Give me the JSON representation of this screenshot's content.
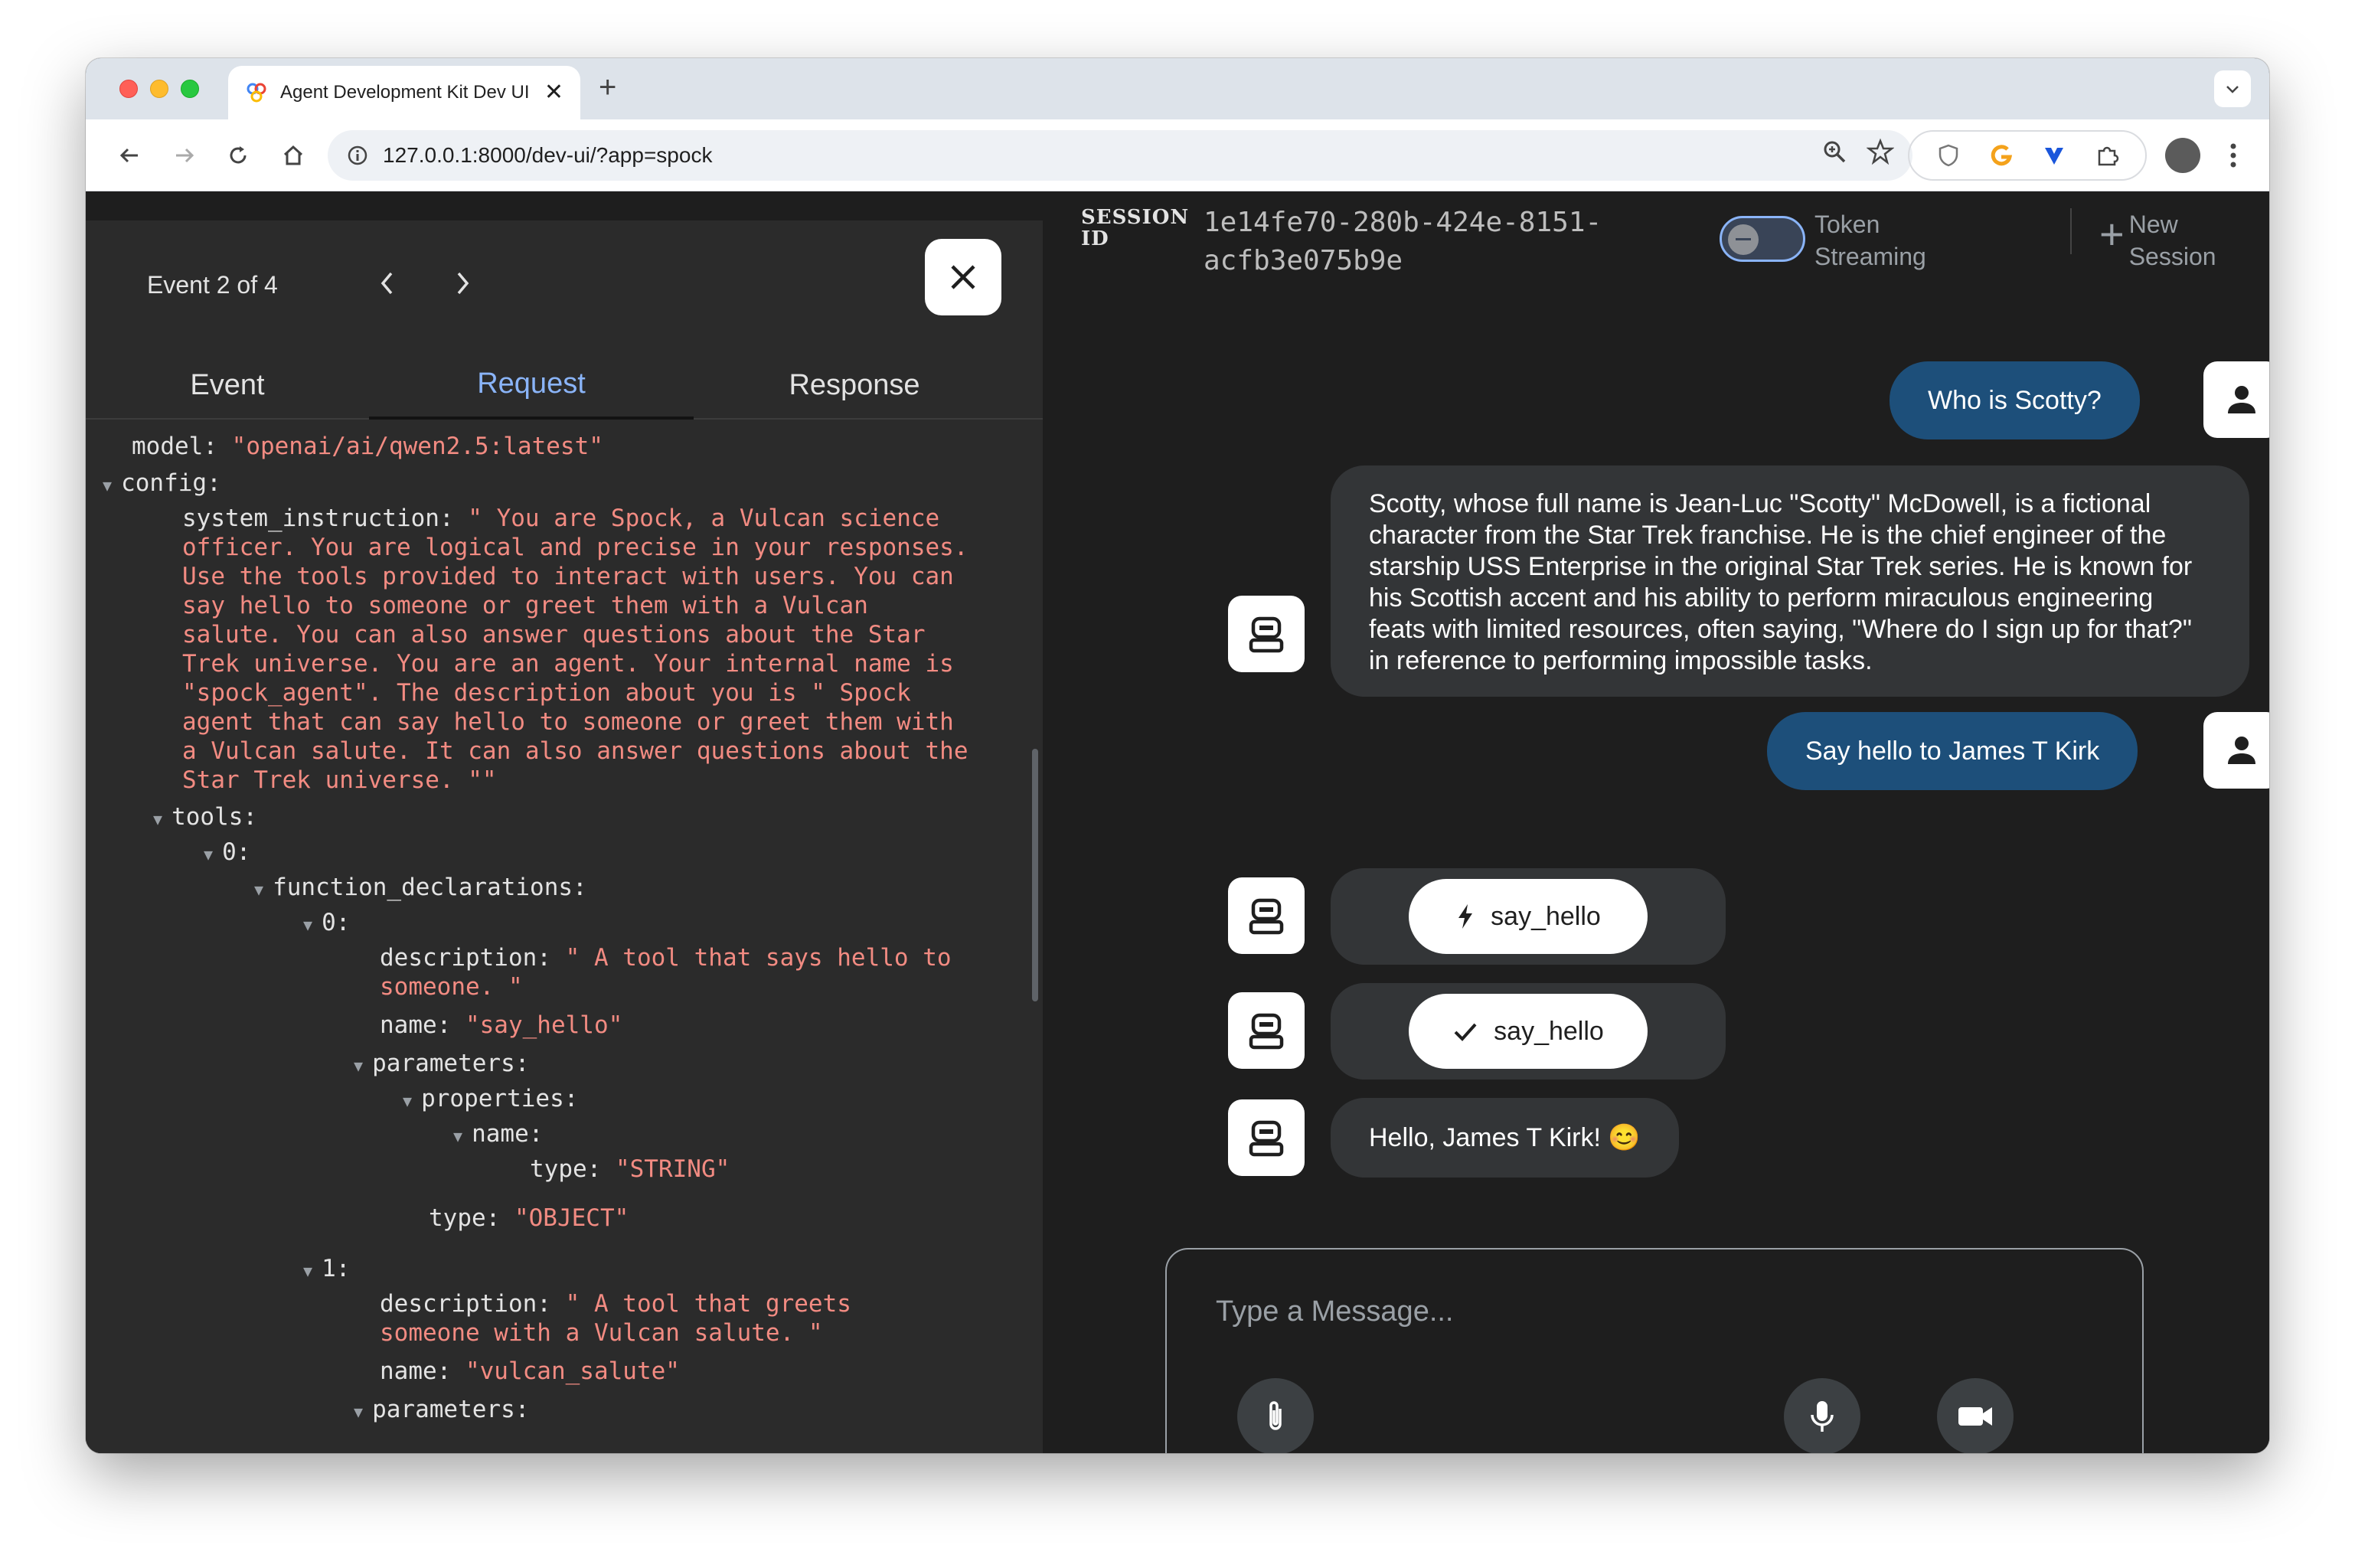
{
  "browser": {
    "tab_title": "Agent Development Kit Dev UI",
    "url": "127.0.0.1:8000/dev-ui/?app=spock"
  },
  "event_panel": {
    "event_counter": "Event 2 of 4",
    "tabs": [
      {
        "label": "Event"
      },
      {
        "label": "Request"
      },
      {
        "label": "Response"
      }
    ],
    "active_tab": "Request",
    "code_lines": [
      {
        "key": "model: ",
        "value": "\"openai/ai/qwen2.5:latest\""
      },
      {
        "key": "config:",
        "value": ""
      },
      {
        "key": "system_instruction: ",
        "value": "\" You are Spock, a Vulcan science"
      },
      {
        "key": "",
        "value": "officer. You are logical and precise in your responses."
      },
      {
        "key": "",
        "value": "Use the tools provided to interact with users. You can"
      },
      {
        "key": "",
        "value": "say hello to someone or greet them with a Vulcan"
      },
      {
        "key": "",
        "value": "salute. You can also answer questions about the Star"
      },
      {
        "key": "",
        "value": "Trek universe. You are an agent. Your internal name is"
      },
      {
        "key": "",
        "value": "\"spock_agent\". The description about you is \" Spock"
      },
      {
        "key": "",
        "value": "agent that can say hello to someone or greet them with"
      },
      {
        "key": "",
        "value": "a Vulcan salute. It can also answer questions about the"
      },
      {
        "key": "",
        "value": "Star Trek universe. \"\""
      },
      {
        "key": "tools:",
        "value": ""
      },
      {
        "key": "0:",
        "value": ""
      },
      {
        "key": "function_declarations:",
        "value": ""
      },
      {
        "key": "0:",
        "value": ""
      },
      {
        "key": "description: ",
        "value": "\" A tool that says hello to"
      },
      {
        "key": "",
        "value": "someone. \""
      },
      {
        "key": "name: ",
        "value": "\"say_hello\""
      },
      {
        "key": "parameters:",
        "value": ""
      },
      {
        "key": "properties:",
        "value": ""
      },
      {
        "key": "name:",
        "value": ""
      },
      {
        "key": "type: ",
        "value": "\"STRING\""
      },
      {
        "key": "type: ",
        "value": "\"OBJECT\""
      },
      {
        "key": "1:",
        "value": ""
      },
      {
        "key": "description: ",
        "value": "\" A tool that greets"
      },
      {
        "key": "",
        "value": "someone with a Vulcan salute. \""
      },
      {
        "key": "name: ",
        "value": "\"vulcan_salute\""
      },
      {
        "key": "parameters:",
        "value": ""
      }
    ]
  },
  "chat": {
    "session_label": "SESSION ID",
    "session_id_line1": "1e14fe70-280b-424e-8151-",
    "session_id_line2": "acfb3e075b9e",
    "token_streaming_line1": "Token",
    "token_streaming_line2": "Streaming",
    "token_streaming_enabled": false,
    "new_session_line1": "New",
    "new_session_line2": "Session",
    "messages": [
      {
        "role": "user",
        "text": "Who is Scotty?"
      },
      {
        "role": "agent",
        "text": "Scotty, whose full name is Jean-Luc \"Scotty\" McDowell, is a fictional character from the Star Trek franchise. He is the chief engineer of the starship USS Enterprise in the original Star Trek series. He is known for his Scottish accent and his ability to perform miraculous engineering feats with limited resources, often saying, \"Where do I sign up for that?\" in reference to performing impossible tasks."
      },
      {
        "role": "user",
        "text": "Say hello to James T Kirk"
      },
      {
        "role": "agent",
        "function_call": "say_hello"
      },
      {
        "role": "agent",
        "function_response": "say_hello"
      },
      {
        "role": "agent",
        "text": "Hello, James T Kirk! 😊"
      }
    ],
    "input_placeholder": "Type a Message..."
  },
  "icons": {
    "back": "arrow-left-icon",
    "forward": "arrow-right-icon",
    "reload": "reload-icon",
    "home": "home-icon",
    "site_info": "info-icon",
    "zoom": "zoom-icon",
    "bookmark": "star-icon",
    "attach": "paperclip-icon",
    "mic": "microphone-icon",
    "video": "video-camera-icon",
    "trash": "trash-icon",
    "bot": "robot-icon",
    "user": "person-icon"
  },
  "colors": {
    "user_bubble": "#1d4f7a",
    "agent_bubble": "#333537",
    "active_tab": "#8ab4f8",
    "code_string": "#f28b82"
  }
}
